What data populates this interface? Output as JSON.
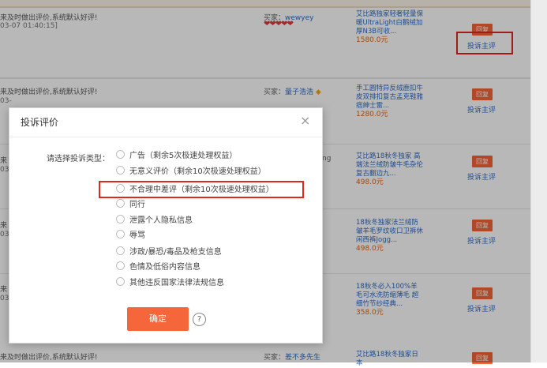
{
  "rows": [
    {
      "comment": "来及时做出评价,系统默认好评!",
      "date": "03-07 01:40:15]",
      "buyer_prefix": "买家：",
      "buyer_name": "wewyey",
      "buyer_badge": "❤❤❤❤❤",
      "product_title": "艾比路独家轻奢轻量保暖UltraLight白鹅绒加厚N3B可收...",
      "price": "1580.0",
      "price_unit": "元",
      "reply_label": "回复",
      "complain_label": "投诉主评"
    },
    {
      "comment": "来及时做出评价,系统默认好评!",
      "date": "03-",
      "buyer_prefix": "买家：",
      "buyer_name": "量子浩浩",
      "buyer_badge": "◆",
      "product_title": "手工圆特异反绒鹿扣牛皮双排扣复古孟克鞋雅痞绅士雷...",
      "price": "1280.0",
      "price_unit": "元",
      "reply_label": "回复",
      "complain_label": "投诉主评"
    },
    {
      "comment": "来",
      "date": "03-",
      "buyer_prefix": "",
      "buyer_name": "ng",
      "buyer_badge": "",
      "product_title": "艾比路18秋冬独家 高端法兰绒防皱牛毛杂伦复古翻边九...",
      "price": "498.0",
      "price_unit": "元",
      "reply_label": "回复",
      "complain_label": "投诉主评"
    },
    {
      "comment": "来",
      "date": "03-",
      "buyer_prefix": "",
      "buyer_name": "",
      "buyer_badge": "",
      "product_title": "18秋冬独家法兰绒防皱羊毛罗纹收口卫裤休闲西裤Jogg...",
      "price": "498.0",
      "price_unit": "元",
      "reply_label": "回复",
      "complain_label": "投诉主评"
    },
    {
      "comment": "来",
      "date": "03-",
      "buyer_prefix": "",
      "buyer_name": "",
      "buyer_badge": "",
      "product_title": "18秋冬必入100%羊毛可水洗防缩薄毛 超细竹节纱经典...",
      "price": "358.0",
      "price_unit": "元",
      "reply_label": "回复",
      "complain_label": "投诉主评"
    },
    {
      "comment": "来及时做出评价,系统默认好评!",
      "date": "",
      "buyer_prefix": "买家：",
      "buyer_name": "差不多先生",
      "buyer_badge": "",
      "product_title": "艾比路18秋冬独家日本",
      "price": "",
      "price_unit": "",
      "reply_label": "回复",
      "complain_label": ""
    }
  ],
  "modal": {
    "title": "投诉评价",
    "close_icon": "×",
    "type_label": "请选择投诉类型：",
    "options": [
      "广告（剩余5次极速处理权益）",
      "无意义评价（剩余10次极速处理权益）",
      "不合理中差评（剩余10次极速处理权益）",
      "同行",
      "泄露个人隐私信息",
      "辱骂",
      "涉政/暴恐/毒品及枪支信息",
      "色情及低俗内容信息",
      "其他违反国家法律法规信息"
    ],
    "confirm_label": "确定",
    "help_icon": "?"
  },
  "colors": {
    "accent": "#f5663a",
    "link": "#2c6bc7",
    "highlight": "#e0281e",
    "price": "#e8620e"
  }
}
